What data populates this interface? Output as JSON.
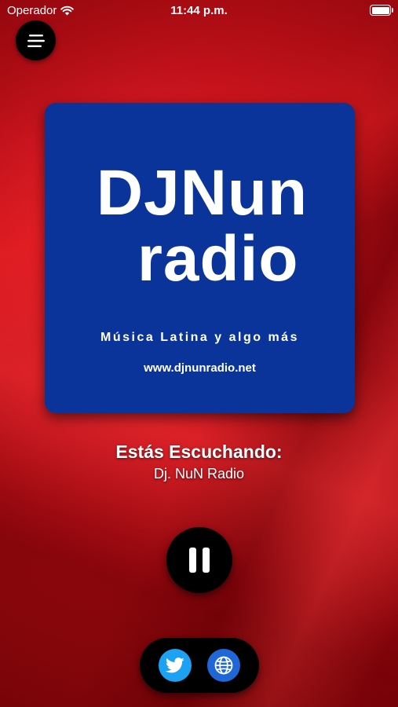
{
  "status_bar": {
    "carrier": "Operador",
    "time": "11:44 p.m.",
    "battery_level": 1.0
  },
  "menu": {
    "icon": "hamburger-menu-icon"
  },
  "artwork": {
    "logo_line1": "DJNun",
    "logo_line2": "radio",
    "tagline": "Música Latina y algo más",
    "website": "www.djnunradio.net",
    "background_color": "#0a3499"
  },
  "now_playing": {
    "label": "Estás Escuchando:",
    "station": "Dj. NuN Radio"
  },
  "player": {
    "state_icon": "pause-icon"
  },
  "social": {
    "twitter_icon": "twitter-icon",
    "web_icon": "globe-icon",
    "twitter_color": "#1da1f2",
    "web_color": "#1f66d6"
  },
  "colors": {
    "background": "#c4121b",
    "controls": "#000000"
  }
}
